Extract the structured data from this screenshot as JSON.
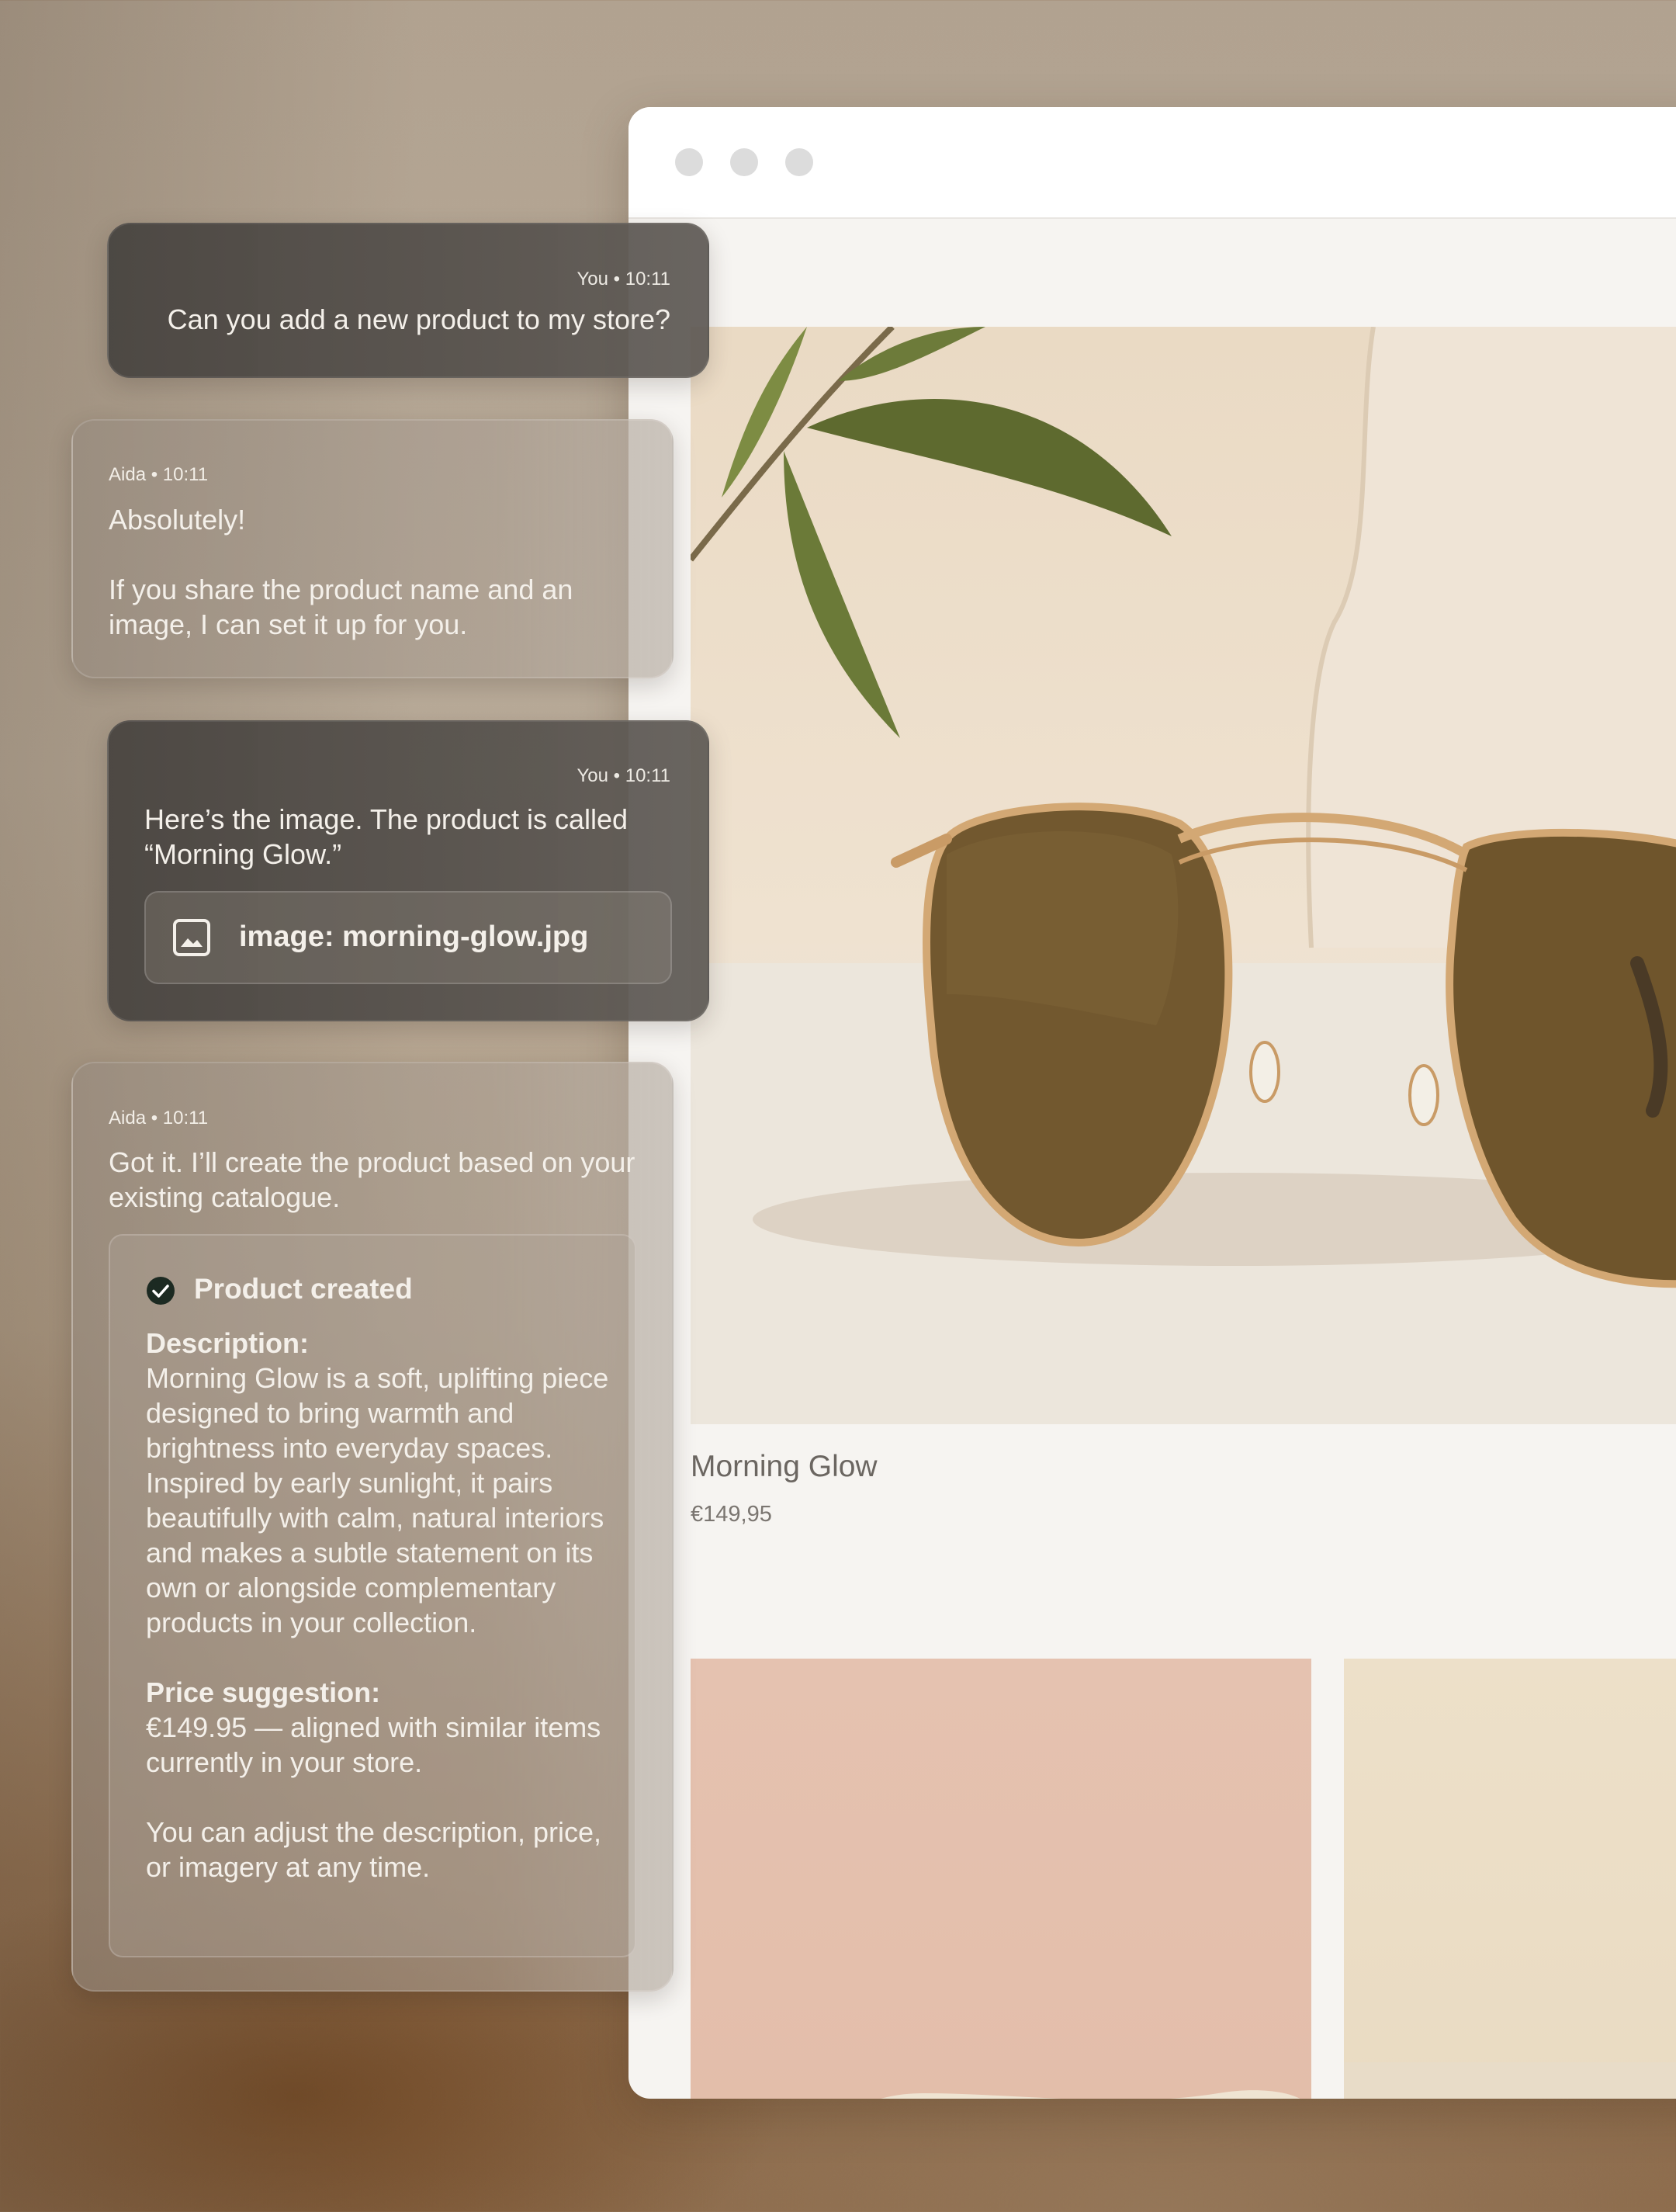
{
  "browser": {
    "product": {
      "name": "Morning Glow",
      "price": "€149,95"
    }
  },
  "chat": {
    "messages": [
      {
        "meta": "You • 10:11",
        "text": "Can you add a new product to my store?"
      },
      {
        "meta": "Aida • 10:11",
        "line1": "Absolutely!",
        "line2": "If you share the product name and an image, I can set it up for you."
      },
      {
        "meta": "You • 10:11",
        "text": "Here’s the image. The product is called “Morning Glow.”",
        "attachment": "image: morning-glow.jpg"
      },
      {
        "meta": "Aida • 10:11",
        "text": "Got it. I’ll create the product based on your existing catalogue.",
        "card": {
          "title": "Product created",
          "description_label": "Description:",
          "description": "Morning Glow is a soft, uplifting piece designed to bring warmth and brightness into everyday spaces. Inspired by early sunlight, it pairs beautifully with calm, natural interiors and makes a subtle statement on its own or alongside complementary products in your collection.",
          "price_label": "Price suggestion:",
          "price_text": "€149.95 — aligned with similar items currently in your store.",
          "footer": "You can adjust the description, price, or imagery at any time."
        }
      }
    ]
  },
  "icons": {
    "window_dots": "traffic-light-dots",
    "attachment": "image-icon",
    "success": "check-circle-icon"
  },
  "colors": {
    "user_bubble": "#4f4b47",
    "ai_bubble": "#9e9083",
    "page_bg": "#f6f4f1",
    "check": "#1c2a22"
  }
}
